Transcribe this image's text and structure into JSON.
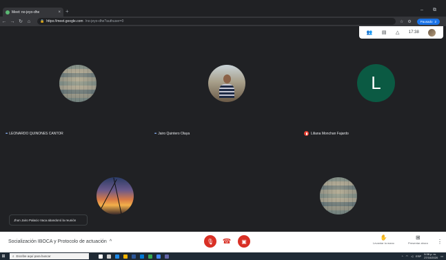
{
  "browser": {
    "tab_title": "Meet: no-jeyo-dhe",
    "tab_close": "×",
    "new_tab": "+",
    "window_controls": [
      "–",
      "⧉"
    ],
    "nav_icons": [
      "back-icon",
      "forward-icon",
      "reload-icon",
      "home-icon"
    ],
    "url_host": "https://meet.google.com",
    "url_path": "/no-jeyo-dhe?authuser=0",
    "profile_label": "Pausado",
    "profile_badge": "2"
  },
  "meet_top": {
    "time": "17:38"
  },
  "participants": [
    {
      "name": "LEONARDO QUINONES CANTOR",
      "avatar": "mosaic"
    },
    {
      "name": "Jairo Quintero Olaya",
      "avatar": "photo"
    },
    {
      "name": "Liliana Monchan Fajardo",
      "avatar": "letter",
      "letter": "L",
      "muted": true
    }
  ],
  "toast": "Jhon Jairo Palacio Vaca abandonó la reunión",
  "meeting": {
    "title": "Socialización IBOCA y Protocolo de actuación",
    "raise_hand_label": "Levantar la mano",
    "present_label": "Presentar ahora"
  },
  "taskbar": {
    "search_placeholder": "Escribe aquí para buscar",
    "tray_lang": "ESP",
    "clock_time": "5:38 p. m.",
    "clock_date": "27/10/2020"
  }
}
